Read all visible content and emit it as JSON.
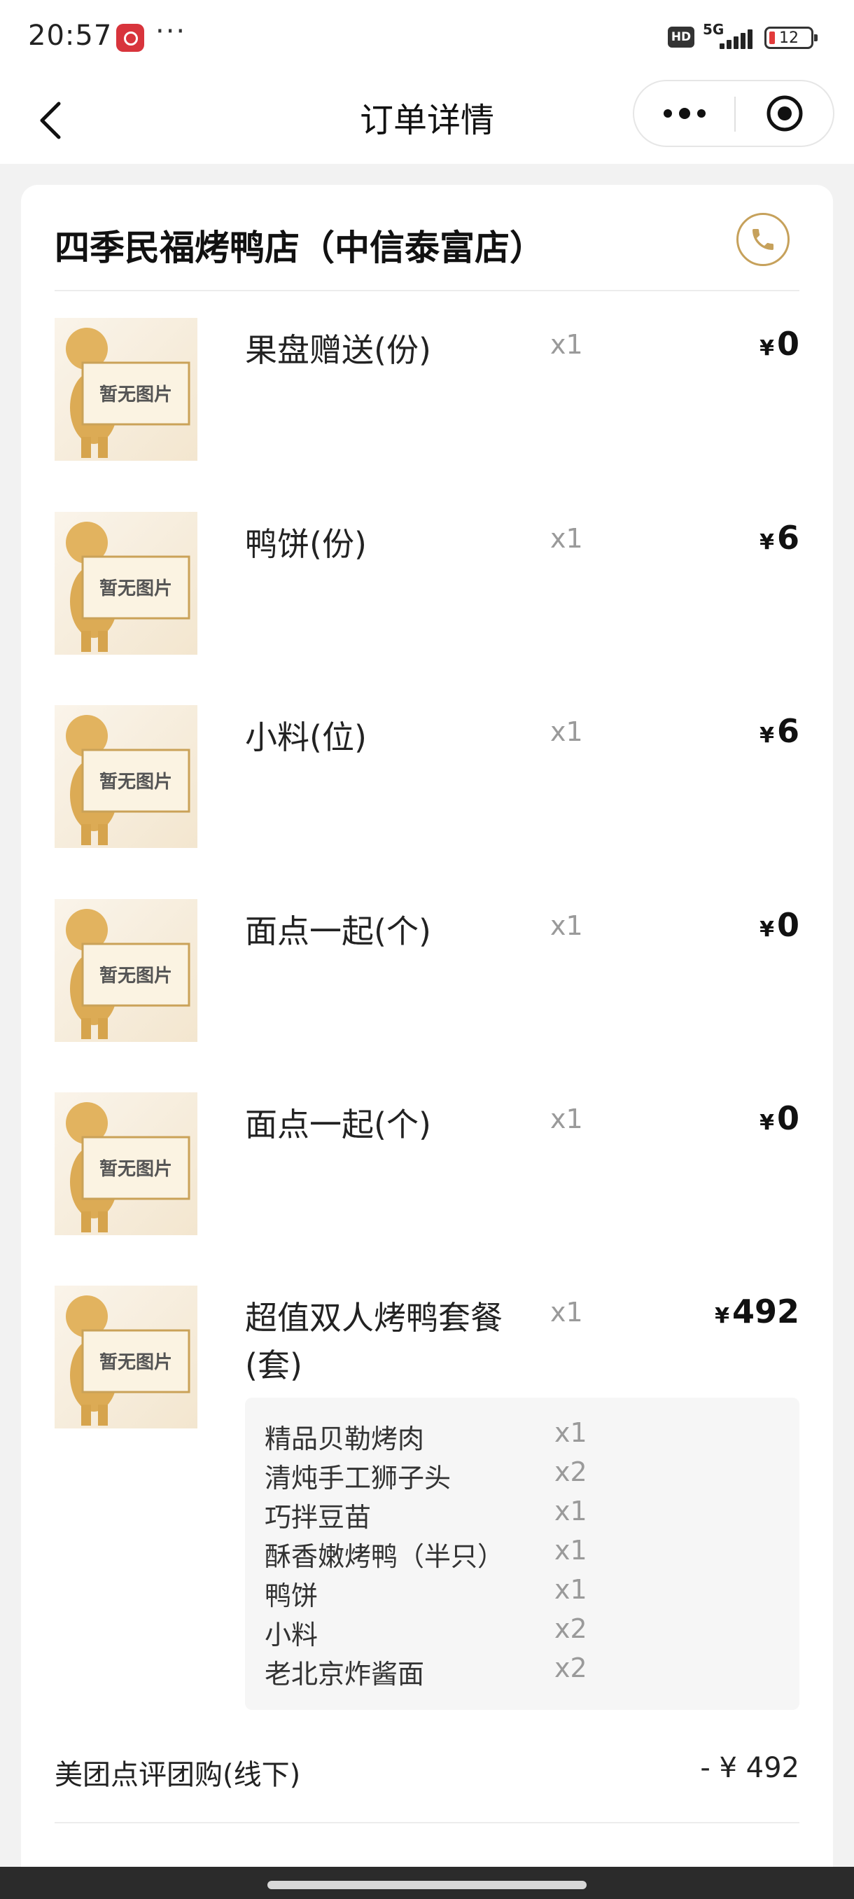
{
  "status_bar": {
    "time": "20:57",
    "more": "···",
    "hd": "HD",
    "network": "5G",
    "battery": "12"
  },
  "nav": {
    "title": "订单详情"
  },
  "store": {
    "name": "四季民福烤鸭店（中信泰富店）"
  },
  "placeholder_text": "暂无图片",
  "currency": "¥",
  "items": [
    {
      "name": "果盘赠送(份)",
      "qty": "x1",
      "price": "0"
    },
    {
      "name": "鸭饼(份)",
      "qty": "x1",
      "price": "6"
    },
    {
      "name": "小料(位)",
      "qty": "x1",
      "price": "6"
    },
    {
      "name": "面点一起(个)",
      "qty": "x1",
      "price": "0"
    },
    {
      "name": "面点一起(个)",
      "qty": "x1",
      "price": "0"
    },
    {
      "name": "超值双人烤鸭套餐(套)",
      "qty": "x1",
      "price": "492"
    }
  ],
  "combo_contents": [
    {
      "name": "精品贝勒烤肉",
      "qty": "x1"
    },
    {
      "name": "清炖手工狮子头",
      "qty": "x2"
    },
    {
      "name": "巧拌豆苗",
      "qty": "x1"
    },
    {
      "name": "酥香嫩烤鸭（半只）",
      "qty": "x1"
    },
    {
      "name": "鸭饼",
      "qty": "x1"
    },
    {
      "name": "小料",
      "qty": "x2"
    },
    {
      "name": "老北京炸酱面",
      "qty": "x2"
    }
  ],
  "discount": {
    "label": "美团点评团购(线下)",
    "value": "- ¥ 492"
  },
  "colors": {
    "accent_gold": "#c6a15b",
    "battery_low": "#e23b3b"
  }
}
